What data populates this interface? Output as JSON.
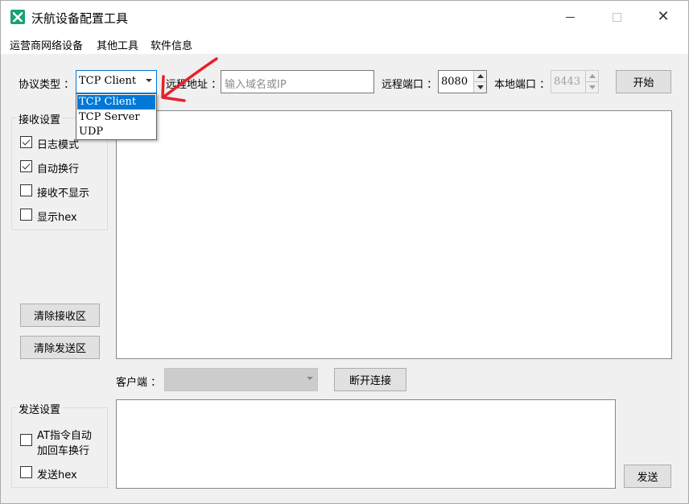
{
  "window": {
    "title": "沃航设备配置工具",
    "close_glyph": "✕"
  },
  "menu": [
    "运营商网络设备",
    "其他工具",
    "软件信息"
  ],
  "connection": {
    "protocol_label": "协议类型 ：",
    "protocol_value": "TCP Client",
    "protocol_options": [
      "TCP Client",
      "TCP Server",
      "UDP"
    ],
    "remote_addr_label": "远程地址 ：",
    "remote_addr_placeholder": "输入域名或IP",
    "remote_port_label": "远程端口 ：",
    "remote_port_value": "8080",
    "local_port_label": "本地端口 ：",
    "local_port_value": "8443",
    "start_button": "开始"
  },
  "receive_settings": {
    "title": "接收设置",
    "options": [
      {
        "label": "日志模式",
        "checked": true
      },
      {
        "label": "自动换行",
        "checked": true
      },
      {
        "label": "接收不显示",
        "checked": false
      },
      {
        "label": "显示hex",
        "checked": false
      }
    ]
  },
  "actions": {
    "clear_receive": "清除接收区",
    "clear_send": "清除发送区"
  },
  "client": {
    "label": "客户端 ：",
    "value": "",
    "disconnect_button": "断开连接"
  },
  "send_settings": {
    "title": "发送设置",
    "options": [
      {
        "label": "AT指令自动",
        "label2": "加回车换行",
        "checked": false
      },
      {
        "label": "发送hex",
        "checked": false
      }
    ],
    "send_button": "发送"
  },
  "colors": {
    "accent": "#0078d7",
    "annotation": "#e8202a",
    "app_icon": "#1aa179"
  }
}
